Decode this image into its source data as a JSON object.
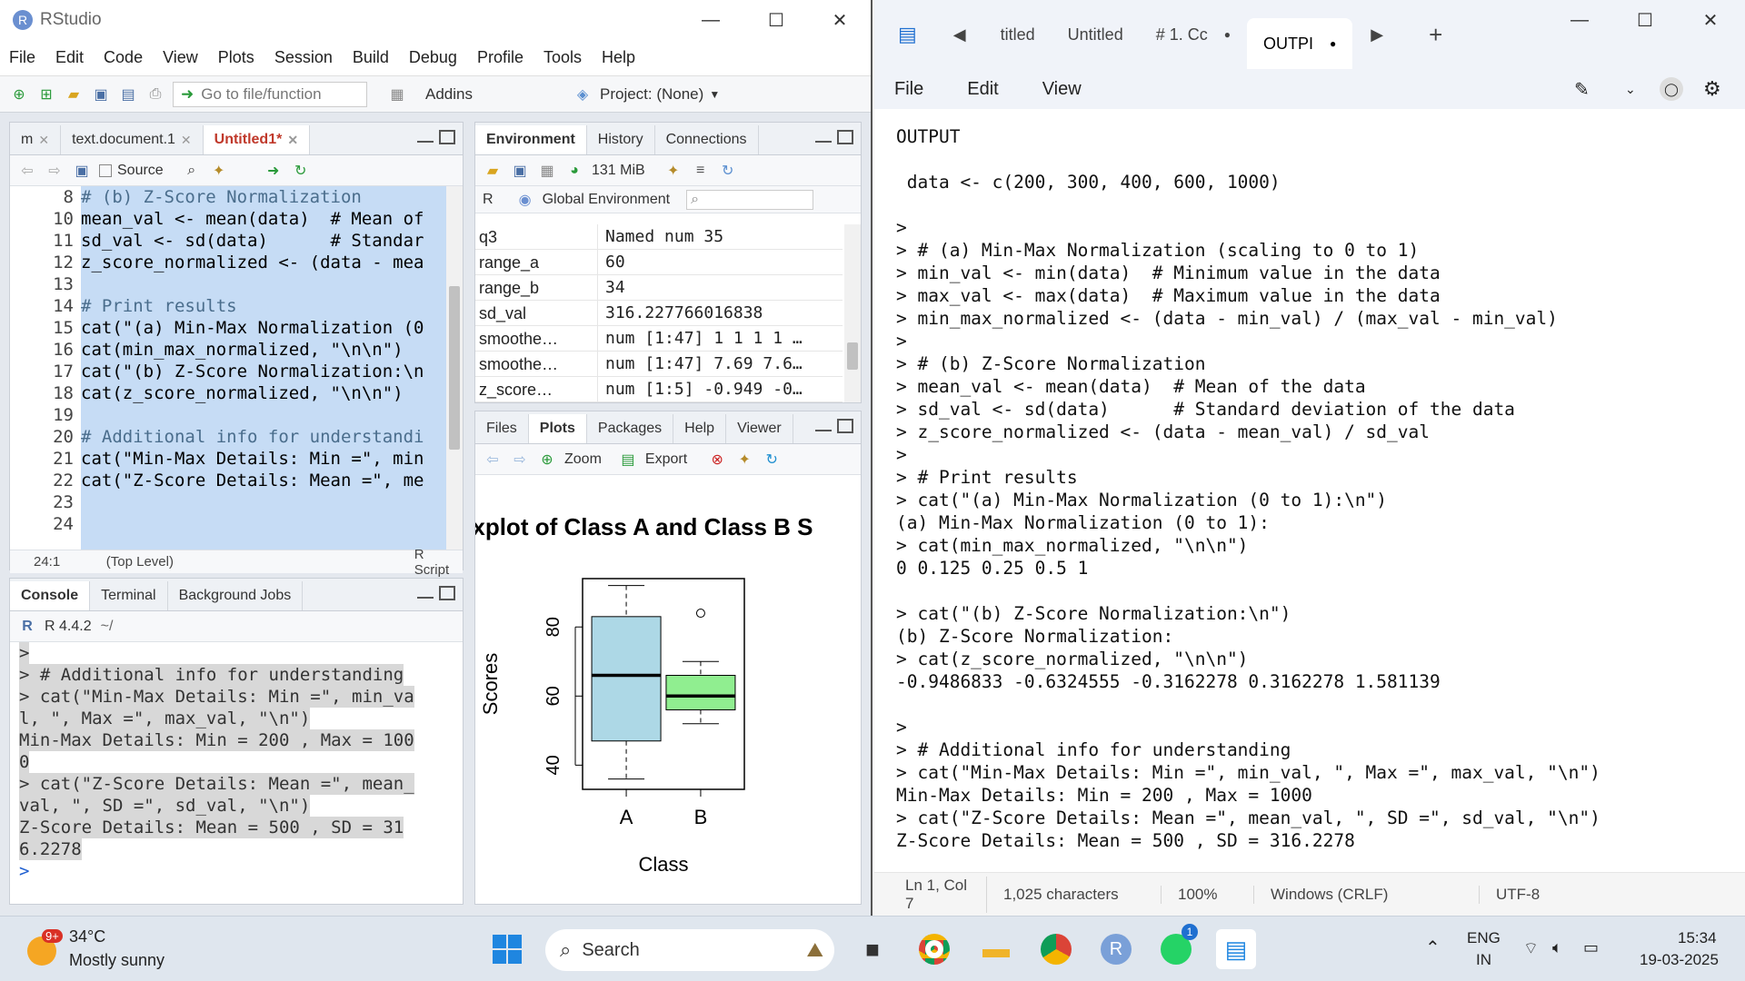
{
  "rstudio": {
    "title": "RStudio",
    "menu": [
      "File",
      "Edit",
      "Code",
      "View",
      "Plots",
      "Session",
      "Build",
      "Debug",
      "Profile",
      "Tools",
      "Help"
    ],
    "toolbar": {
      "goto_placeholder": "Go to file/function",
      "addins": "Addins",
      "project": "Project: (None)"
    },
    "editor": {
      "tabs": [
        {
          "label": "m",
          "active": false
        },
        {
          "label": "text.document.1",
          "active": false
        },
        {
          "label": "Untitled1*",
          "active": true
        }
      ],
      "source_label": "Source",
      "lines": [
        {
          "n": "8",
          "code": "# (b) Z-Score Normalization",
          "cls": "cm"
        },
        {
          "n": "10",
          "code": "mean_val <- mean(data)  # Mean of",
          "cls": ""
        },
        {
          "n": "11",
          "code": "sd_val <- sd(data)      # Standar",
          "cls": ""
        },
        {
          "n": "12",
          "code": "z_score_normalized <- (data - mea",
          "cls": ""
        },
        {
          "n": "13",
          "code": "",
          "cls": ""
        },
        {
          "n": "14",
          "code": "# Print results",
          "cls": "cm"
        },
        {
          "n": "15",
          "code": "cat(\"(a) Min-Max Normalization (0",
          "cls": ""
        },
        {
          "n": "16",
          "code": "cat(min_max_normalized, \"\\n\\n\")",
          "cls": ""
        },
        {
          "n": "17",
          "code": "cat(\"(b) Z-Score Normalization:\\n",
          "cls": ""
        },
        {
          "n": "18",
          "code": "cat(z_score_normalized, \"\\n\\n\")",
          "cls": ""
        },
        {
          "n": "19",
          "code": "",
          "cls": ""
        },
        {
          "n": "20",
          "code": "# Additional info for understandi",
          "cls": "cm"
        },
        {
          "n": "21",
          "code": "cat(\"Min-Max Details: Min =\", min",
          "cls": ""
        },
        {
          "n": "22",
          "code": "cat(\"Z-Score Details: Mean =\", me",
          "cls": ""
        },
        {
          "n": "23",
          "code": "",
          "cls": ""
        },
        {
          "n": "24",
          "code": "",
          "cls": ""
        }
      ],
      "status_pos": "24:1",
      "status_scope": "(Top Level)",
      "status_type": "R Script"
    },
    "console": {
      "tabs": [
        {
          "label": "Console",
          "active": true
        },
        {
          "label": "Terminal",
          "active": false
        },
        {
          "label": "Background Jobs",
          "active": false
        }
      ],
      "version": "R 4.4.2",
      "path": "~/",
      "lines": [
        {
          "text": ">",
          "hl": true
        },
        {
          "text": "> # Additional info for understanding",
          "hl": true
        },
        {
          "text": "> cat(\"Min-Max Details: Min =\", min_va",
          "hl": true
        },
        {
          "text": "l, \", Max =\", max_val, \"\\n\")",
          "hl": true
        },
        {
          "text": "Min-Max Details: Min = 200 , Max = 100",
          "hl": true
        },
        {
          "text": "0",
          "hl": true
        },
        {
          "text": "> cat(\"Z-Score Details: Mean =\", mean_",
          "hl": true
        },
        {
          "text": "val, \", SD =\", sd_val, \"\\n\")",
          "hl": true
        },
        {
          "text": "Z-Score Details: Mean = 500 , SD = 31",
          "hl": true
        },
        {
          "text": "6.2278",
          "hl": true
        },
        {
          "text": ">",
          "hl": false
        }
      ]
    },
    "environment": {
      "tabs": [
        {
          "label": "Environment",
          "active": true
        },
        {
          "label": "History",
          "active": false
        },
        {
          "label": "Connections",
          "active": false
        }
      ],
      "memory": "131 MiB",
      "lang": "R",
      "scope": "Global Environment",
      "rows": [
        {
          "name": "q3",
          "value": "Named num 35"
        },
        {
          "name": "range_a",
          "value": "60"
        },
        {
          "name": "range_b",
          "value": "34"
        },
        {
          "name": "sd_val",
          "value": "316.227766016838"
        },
        {
          "name": "smoothe…",
          "value": "num [1:47] 1 1 1 1 …"
        },
        {
          "name": "smoothe…",
          "value": "num [1:47] 7.69 7.6…"
        },
        {
          "name": "z_score…",
          "value": "num [1:5] -0.949 -0…"
        }
      ]
    },
    "plots": {
      "tabs": [
        {
          "label": "Files",
          "active": false
        },
        {
          "label": "Plots",
          "active": true
        },
        {
          "label": "Packages",
          "active": false
        },
        {
          "label": "Help",
          "active": false
        },
        {
          "label": "Viewer",
          "active": false
        }
      ],
      "zoom_label": "Zoom",
      "export_label": "Export"
    }
  },
  "chart_data": {
    "type": "boxplot",
    "title": "oxplot of Class A and Class B S",
    "xlabel": "Class",
    "ylabel": "Scores",
    "categories": [
      "A",
      "B"
    ],
    "ylim": [
      33,
      94
    ],
    "yticks": [
      40,
      60,
      80
    ],
    "boxes": [
      {
        "name": "A",
        "min": 36,
        "q1": 47,
        "median": 66,
        "q3": 83,
        "max": 92,
        "color": "#add8e6",
        "outliers": []
      },
      {
        "name": "B",
        "min": 52,
        "q1": 56,
        "median": 60,
        "q3": 66,
        "max": 70,
        "color": "#90ee90",
        "outliers": [
          84
        ]
      }
    ]
  },
  "notepad": {
    "tabs": [
      {
        "label": "titled",
        "active": false
      },
      {
        "label": "Untitled",
        "active": false
      },
      {
        "label": "# 1. Cc",
        "active": false
      },
      {
        "label": "OUTPI",
        "active": true
      }
    ],
    "menu": [
      "File",
      "Edit",
      "View"
    ],
    "lines": [
      "OUTPUT",
      "",
      " data <- c(200, 300, 400, 600, 1000)",
      "",
      ">",
      "> # (a) Min-Max Normalization (scaling to 0 to 1)",
      "> min_val <- min(data)  # Minimum value in the data",
      "> max_val <- max(data)  # Maximum value in the data",
      "> min_max_normalized <- (data - min_val) / (max_val - min_val)",
      ">",
      "> # (b) Z-Score Normalization",
      "> mean_val <- mean(data)  # Mean of the data",
      "> sd_val <- sd(data)      # Standard deviation of the data",
      "> z_score_normalized <- (data - mean_val) / sd_val",
      ">",
      "> # Print results",
      "> cat(\"(a) Min-Max Normalization (0 to 1):\\n\")",
      "(a) Min-Max Normalization (0 to 1):",
      "> cat(min_max_normalized, \"\\n\\n\")",
      "0 0.125 0.25 0.5 1",
      "",
      "> cat(\"(b) Z-Score Normalization:\\n\")",
      "(b) Z-Score Normalization:",
      "> cat(z_score_normalized, \"\\n\\n\")",
      "-0.9486833 -0.6324555 -0.3162278 0.3162278 1.581139",
      "",
      ">",
      "> # Additional info for understanding",
      "> cat(\"Min-Max Details: Min =\", min_val, \", Max =\", max_val, \"\\n\")",
      "Min-Max Details: Min = 200 , Max = 1000",
      "> cat(\"Z-Score Details: Mean =\", mean_val, \", SD =\", sd_val, \"\\n\")",
      "Z-Score Details: Mean = 500 , SD = 316.2278"
    ],
    "status": {
      "pos": "Ln 1, Col 7",
      "chars": "1,025 characters",
      "zoom": "100%",
      "eol": "Windows (CRLF)",
      "enc": "UTF-8"
    }
  },
  "taskbar": {
    "weather_temp": "34°C",
    "weather_desc": "Mostly sunny",
    "weather_badge": "9+",
    "search_label": "Search",
    "lang1": "ENG",
    "lang2": "IN",
    "time": "15:34",
    "date": "19-03-2025",
    "whatsapp_badge": "1"
  }
}
